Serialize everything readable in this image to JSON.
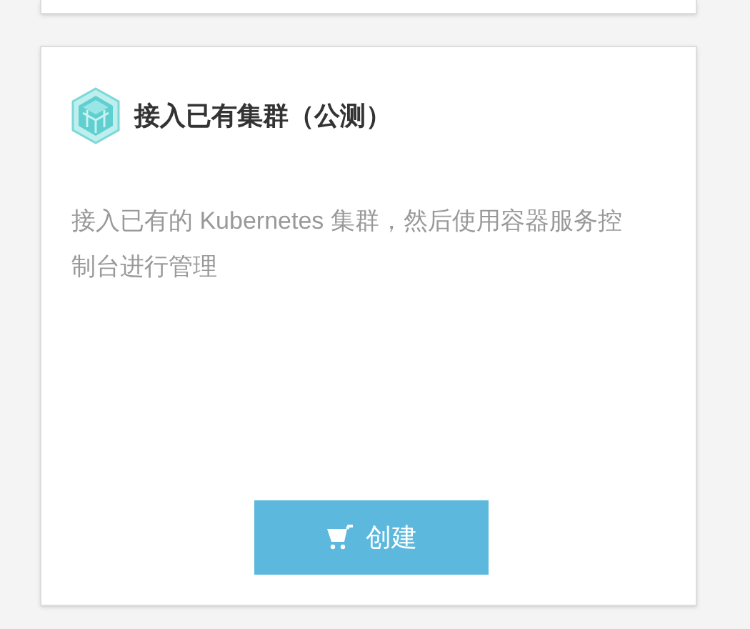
{
  "card": {
    "title": "接入已有集群（公测）",
    "description": "接入已有的 Kubernetes 集群，然后使用容器服务控制台进行管理",
    "button": {
      "label": "创建"
    }
  }
}
